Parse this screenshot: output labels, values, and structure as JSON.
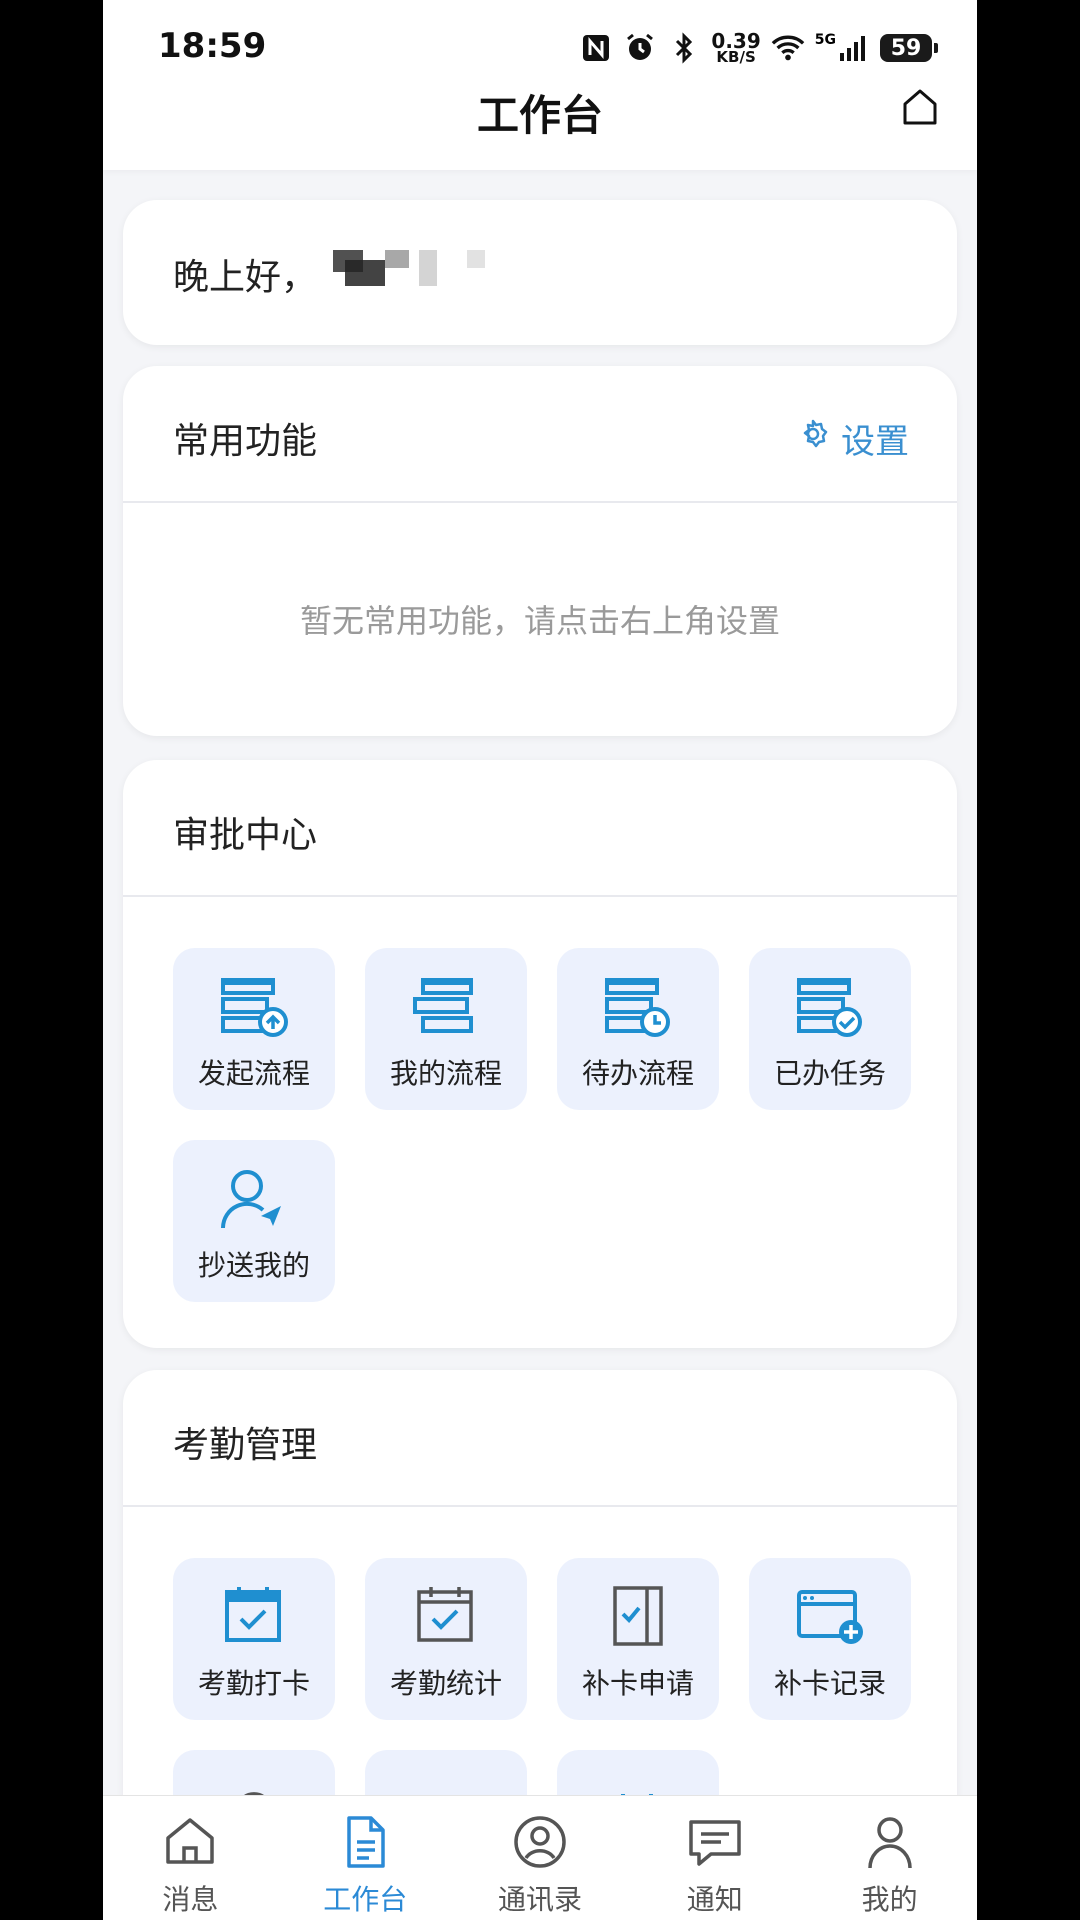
{
  "status_bar": {
    "time": "18:59",
    "speed_value": "0.39",
    "speed_unit": "KB/S",
    "network": "5G",
    "battery": "59"
  },
  "header": {
    "title": "工作台",
    "home_icon": "home-outline-icon"
  },
  "greeting": {
    "text": "晚上好，"
  },
  "common_functions": {
    "title": "常用功能",
    "settings_label": "设置",
    "empty_message": "暂无常用功能，请点击右上角设置"
  },
  "approval_center": {
    "title": "审批中心",
    "items": [
      {
        "label": "发起流程",
        "icon": "flow-start-icon"
      },
      {
        "label": "我的流程",
        "icon": "flow-mine-icon"
      },
      {
        "label": "待办流程",
        "icon": "flow-pending-icon"
      },
      {
        "label": "已办任务",
        "icon": "flow-done-icon"
      },
      {
        "label": "抄送我的",
        "icon": "cc-me-icon"
      }
    ]
  },
  "attendance": {
    "title": "考勤管理",
    "items": [
      {
        "label": "考勤打卡",
        "icon": "clock-in-icon"
      },
      {
        "label": "考勤统计",
        "icon": "attendance-stats-icon"
      },
      {
        "label": "补卡申请",
        "icon": "makeup-apply-icon"
      },
      {
        "label": "补卡记录",
        "icon": "makeup-record-icon"
      }
    ]
  },
  "bottom_nav": {
    "items": [
      {
        "label": "消息",
        "icon": "home-icon",
        "active": false
      },
      {
        "label": "工作台",
        "icon": "document-icon",
        "active": true
      },
      {
        "label": "通讯录",
        "icon": "contacts-icon",
        "active": false
      },
      {
        "label": "通知",
        "icon": "chat-bubble-icon",
        "active": false
      },
      {
        "label": "我的",
        "icon": "person-icon",
        "active": false
      }
    ]
  },
  "colors": {
    "accent": "#2b8ad6",
    "tile_bg": "#ecf1fd",
    "page_bg": "#f4f5f8"
  }
}
